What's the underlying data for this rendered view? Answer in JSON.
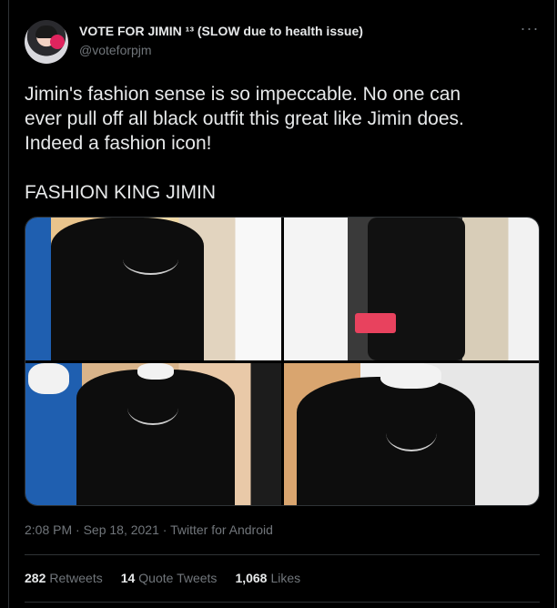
{
  "tweet": {
    "display_name": "VOTE FOR JIMIN ¹³ (SLOW due to health issue)",
    "handle": "@voteforpjm",
    "more_icon": "···",
    "text": "Jimin's fashion sense is so impeccable. No one can\never pull off all black outfit this great like Jimin does.\nIndeed a fashion icon!\n\nFASHION KING JIMIN",
    "media_count": 4,
    "timestamp": "2:08 PM · Sep 18, 2021 · ",
    "source": "Twitter for Android",
    "stats": [
      {
        "value": "282",
        "label": "Retweets"
      },
      {
        "value": "14",
        "label": "Quote Tweets"
      },
      {
        "value": "1,068",
        "label": "Likes"
      }
    ]
  }
}
